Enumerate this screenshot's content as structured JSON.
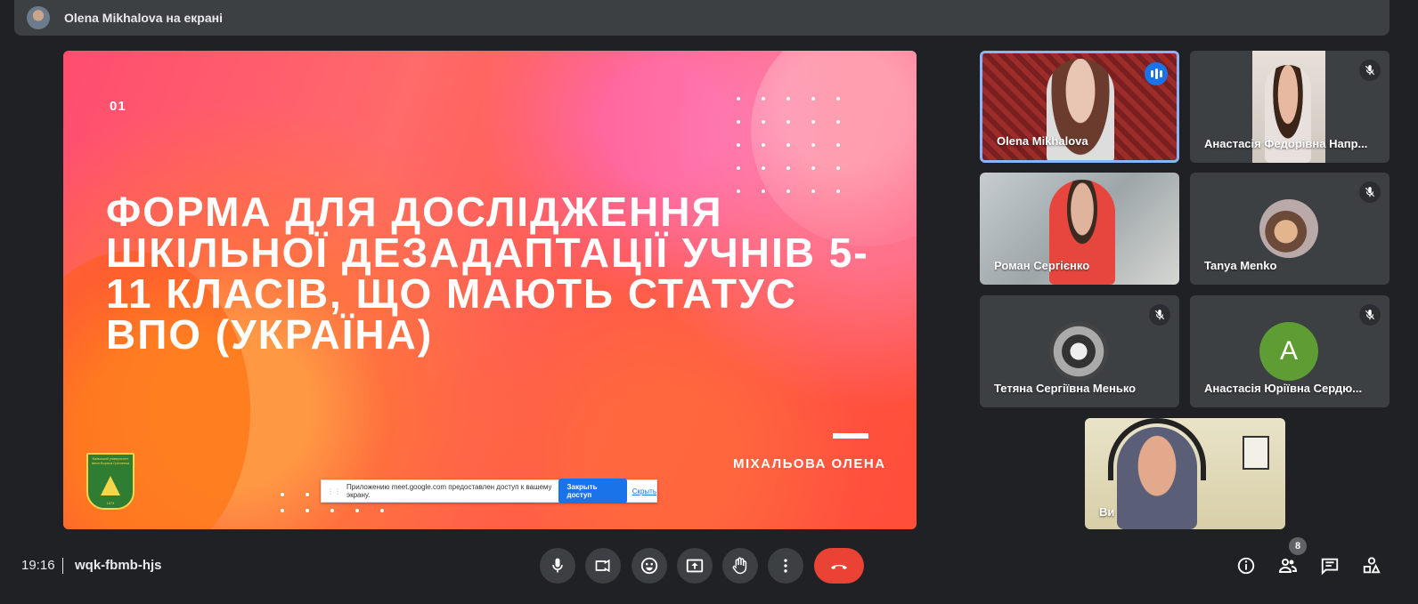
{
  "banner": {
    "text": "Olena Mikhalova на екрані"
  },
  "slide": {
    "number": "01",
    "title": "ФОРМА ДЛЯ ДОСЛІДЖЕННЯ ШКІЛЬНОЇ ДЕЗАДАПТАЦІЇ УЧНІВ 5-11 КЛАСІВ, ЩО МАЮТЬ СТАТУС ВПО (УКРАЇНА)",
    "author": "МІХАЛЬОВА ОЛЕНА",
    "logo_text": "Київський університет імені Бориса Грінченка",
    "logo_year": "1874"
  },
  "share_bar": {
    "message": "Приложению meet.google.com предоставлен доступ к вашему экрану.",
    "stop_label": "Закрыть доступ",
    "hide_label": "Скрыть"
  },
  "participants": [
    {
      "name": "Olena Mikhalova",
      "speaking": true
    },
    {
      "name": "Анастасія Федорівна Напр...",
      "muted": true
    },
    {
      "name": "Роман Сергієнко"
    },
    {
      "name": "Tanya Menko",
      "muted": true
    },
    {
      "name": "Тетяна Сергіївна Менько",
      "muted": true
    },
    {
      "name": "Анастасія Юріївна Сердю...",
      "muted": true,
      "avatar_letter": "А"
    }
  ],
  "self_view": {
    "name": "Ви"
  },
  "bottom_bar": {
    "time": "19:16",
    "meeting_code": "wqk-fbmb-hjs",
    "participants_count": "8"
  },
  "colors": {
    "background": "#202124",
    "tile": "#3c4043",
    "hangup": "#ea4335",
    "accent": "#1a73e8",
    "active_border": "#8ab4f8"
  }
}
